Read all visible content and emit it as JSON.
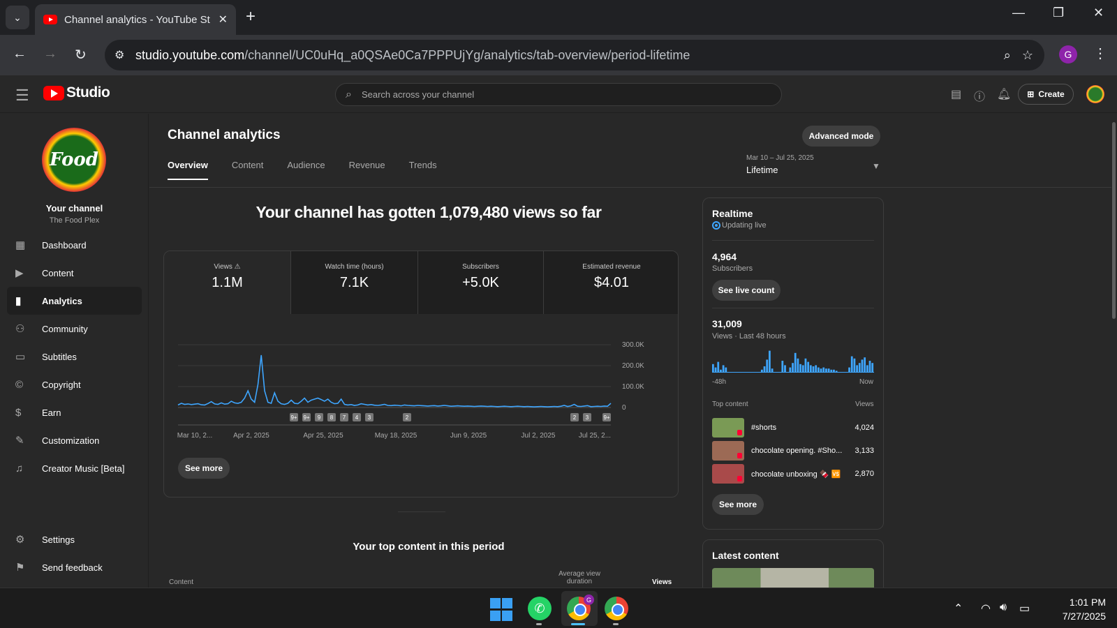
{
  "browser": {
    "tab_title": "Channel analytics - YouTube St",
    "url_domain": "studio.youtube.com",
    "url_path": "/channel/UC0uHq_a0QSAe0Ca7PPPUjYg/analytics/tab-overview/period-lifetime",
    "profile_initial": "G"
  },
  "header": {
    "logo_text": "Studio",
    "search_placeholder": "Search across your channel",
    "create_label": "Create"
  },
  "sidebar": {
    "avatar_text": "Food",
    "channel_label": "Your channel",
    "channel_name": "The Food Plex",
    "items": [
      {
        "label": "Dashboard"
      },
      {
        "label": "Content"
      },
      {
        "label": "Analytics"
      },
      {
        "label": "Community"
      },
      {
        "label": "Subtitles"
      },
      {
        "label": "Copyright"
      },
      {
        "label": "Earn"
      },
      {
        "label": "Customization"
      },
      {
        "label": "Creator Music [Beta]"
      },
      {
        "label": "Settings"
      },
      {
        "label": "Send feedback"
      }
    ]
  },
  "main": {
    "title": "Channel analytics",
    "advanced_mode": "Advanced mode",
    "date_range": "Mar 10 – Jul 25, 2025",
    "period": "Lifetime",
    "tabs": [
      "Overview",
      "Content",
      "Audience",
      "Revenue",
      "Trends"
    ],
    "headline": "Your channel has gotten 1,079,480 views so far",
    "metrics": [
      {
        "label": "Views",
        "value": "1.1M"
      },
      {
        "label": "Watch time (hours)",
        "value": "7.1K"
      },
      {
        "label": "Subscribers",
        "value": "+5.0K"
      },
      {
        "label": "Estimated revenue",
        "value": "$4.01"
      }
    ],
    "see_more": "See more",
    "top_content_title": "Your top content in this period",
    "top_content_cols": {
      "content": "Content",
      "avg_view_duration": "Average view duration",
      "views": "Views"
    }
  },
  "chart_data": {
    "type": "line",
    "x_tick_labels": [
      "Mar 10, 2...",
      "Apr 2, 2025",
      "Apr 25, 2025",
      "May 18, 2025",
      "Jun 9, 2025",
      "Jul 2, 2025",
      "Jul 25, 2..."
    ],
    "y_tick_labels": [
      "300.0K",
      "200.0K",
      "100.0K",
      "0"
    ],
    "ylim": [
      0,
      300000
    ],
    "grid": true,
    "series": [
      {
        "values": [
          12000,
          20000,
          15000,
          17000,
          14000,
          16000,
          18000,
          13000,
          12000,
          19000,
          28000,
          17000,
          15000,
          22000,
          16000,
          18000,
          30000,
          22000,
          20000,
          25000,
          45000,
          80000,
          40000,
          25000,
          110000,
          250000,
          80000,
          25000,
          20000,
          70000,
          30000,
          18000,
          15000,
          20000,
          35000,
          20000,
          18000,
          30000,
          45000,
          25000,
          35000,
          40000,
          45000,
          38000,
          30000,
          40000,
          25000,
          18000,
          20000,
          40000,
          15000,
          12000,
          14000,
          10000,
          12000,
          18000,
          15000,
          12000,
          14000,
          11000,
          10000,
          12000,
          15000,
          10000,
          9000,
          11000,
          10000,
          8000,
          12000,
          10000,
          9000,
          8000,
          10000,
          9000,
          8000,
          7000,
          8000,
          9000,
          7000,
          8000,
          10000,
          8000,
          6000,
          7000,
          8000,
          7000,
          6000,
          7000,
          6000,
          5000,
          6000,
          7000,
          6000,
          5000,
          6000,
          5000,
          4000,
          5000,
          6000,
          5000,
          4000,
          5000,
          6000,
          5000,
          4000,
          5000,
          4000,
          3000,
          4000,
          5000,
          4000,
          3000,
          4000,
          5000,
          4000,
          6000,
          10000,
          5000,
          8000,
          15000,
          6000,
          5000,
          7000,
          9000,
          4000,
          5000,
          6000,
          5000,
          7000,
          6000,
          20000
        ]
      }
    ],
    "annotations": [
      "9+",
      "9+",
      "9",
      "8",
      "7",
      "4",
      "3",
      "2",
      "2",
      "3",
      "9+"
    ]
  },
  "realtime": {
    "title": "Realtime",
    "status": "Updating live",
    "subscribers_value": "4,964",
    "subscribers_label": "Subscribers",
    "see_live_count": "See live count",
    "views_value": "31,009",
    "views_label": "Views · Last 48 hours",
    "axis_start": "-48h",
    "axis_end": "Now",
    "bars": [
      0.35,
      0.2,
      0.45,
      0.1,
      0.3,
      0.2,
      0,
      0,
      0,
      0,
      0,
      0,
      0,
      0,
      0,
      0,
      0,
      0,
      0,
      0.1,
      0.25,
      0.55,
      0.95,
      0.15,
      0,
      0,
      0,
      0.5,
      0.3,
      0,
      0.2,
      0.4,
      0.85,
      0.6,
      0.35,
      0.3,
      0.6,
      0.45,
      0.3,
      0.25,
      0.3,
      0.2,
      0.15,
      0.2,
      0.15,
      0.15,
      0.1,
      0.1,
      0.05,
      0,
      0,
      0,
      0,
      0.2,
      0.7,
      0.6,
      0.3,
      0.4,
      0.55,
      0.65,
      0.3,
      0.5,
      0.4
    ],
    "top_content_label": "Top content",
    "views_col_label": "Views",
    "items": [
      {
        "title": "#shorts",
        "views": "4,024",
        "thumb_color": "#7a9a55"
      },
      {
        "title": "chocolate opening. #Sho...",
        "views": "3,133",
        "thumb_color": "#9c6a55"
      },
      {
        "title": "chocolate unboxing 🍫 🆚",
        "views": "2,870",
        "thumb_color": "#a94a4a"
      }
    ],
    "see_more": "See more"
  },
  "latest": {
    "title": "Latest content"
  },
  "taskbar": {
    "time": "1:01 PM",
    "date": "7/27/2025",
    "chrome_badge": "G"
  }
}
